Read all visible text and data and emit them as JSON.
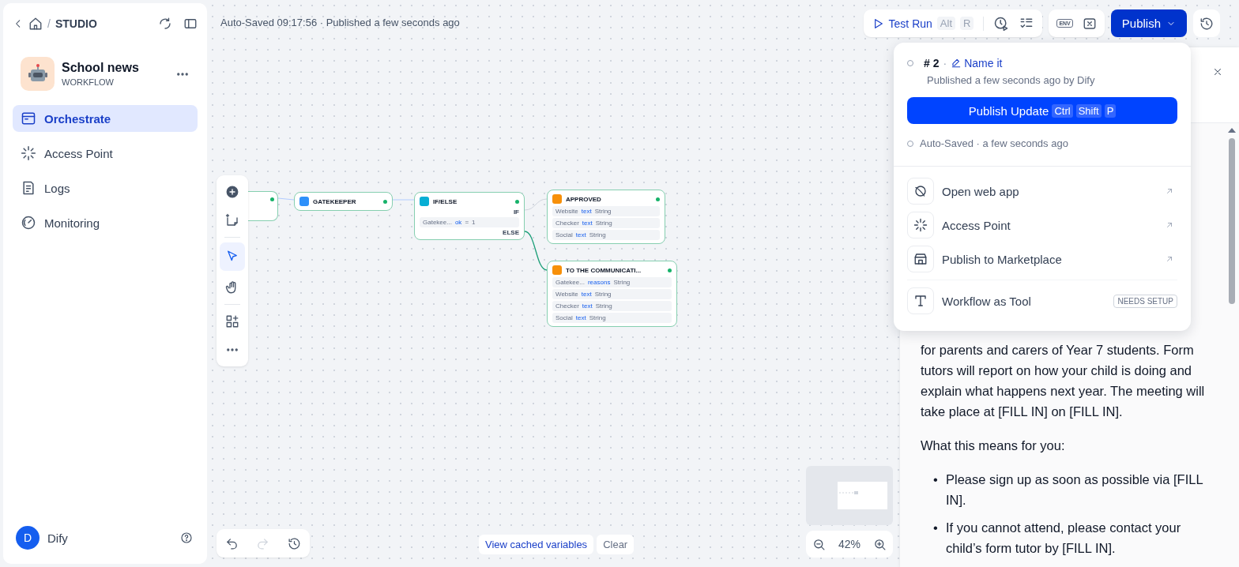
{
  "sidebar": {
    "back_separator": "/",
    "breadcrumb": "STUDIO",
    "app": {
      "name": "School news",
      "type": "WORKFLOW"
    },
    "nav": [
      {
        "label": "Orchestrate",
        "kind": "orchestrate",
        "selected": true
      },
      {
        "label": "Access Point",
        "kind": "access",
        "selected": false
      },
      {
        "label": "Logs",
        "kind": "logs",
        "selected": false
      },
      {
        "label": "Monitoring",
        "kind": "monitor",
        "selected": false
      }
    ],
    "user": {
      "initial": "D",
      "name": "Dify"
    }
  },
  "header": {
    "status": "Auto-Saved 09:17:56 · Published a few seconds ago",
    "test_run": {
      "label": "Test Run",
      "keys": [
        "Alt",
        "R"
      ]
    },
    "env": "ENV",
    "publish": "Publish"
  },
  "canvas": {
    "tools": [
      {
        "kind": "add",
        "selected": false
      },
      {
        "kind": "note",
        "selected": false
      },
      {
        "kind": "pointer",
        "selected": true
      },
      {
        "kind": "hand",
        "selected": false
      },
      {
        "kind": "grid",
        "selected": false
      },
      {
        "kind": "more",
        "selected": false
      }
    ],
    "nodes": [
      {
        "kind": "partial"
      },
      {
        "kind": "code",
        "title": "GATEKEEPER"
      },
      {
        "kind": "ifelse",
        "title": "IF/ELSE",
        "if_label": "IF",
        "else_label": "ELSE",
        "condition": {
          "source": "Gatekee...",
          "var": "ok",
          "op": "=",
          "value": "1"
        }
      },
      {
        "kind": "template",
        "title": "APPROVED",
        "rows": [
          {
            "source": "Website",
            "var": "text",
            "type": "String"
          },
          {
            "source": "Checker",
            "var": "text",
            "type": "String"
          },
          {
            "source": "Social",
            "var": "text",
            "type": "String"
          }
        ]
      },
      {
        "kind": "template",
        "title": "TO THE COMMUNICATI...",
        "rows": [
          {
            "source": "Gatekee...",
            "var": "reasons",
            "type": "String"
          },
          {
            "source": "Website",
            "var": "text",
            "type": "String"
          },
          {
            "source": "Checker",
            "var": "text",
            "type": "String"
          },
          {
            "source": "Social",
            "var": "text",
            "type": "String"
          }
        ]
      }
    ],
    "cached_link": "View cached variables",
    "clear": "Clear",
    "zoom": "42%"
  },
  "publish_menu": {
    "version": "# 2",
    "separator": "·",
    "name_link": "Name it",
    "published": "Published a few seconds ago by Dify",
    "update_button": {
      "label": "Publish Update",
      "keys": [
        "Ctrl",
        "Shift",
        "P"
      ]
    },
    "autosaved": "Auto-Saved · a few seconds ago",
    "actions": [
      {
        "kind": "web",
        "label": "Open web app",
        "external": true
      },
      {
        "kind": "access",
        "label": "Access Point",
        "external": true
      },
      {
        "kind": "store",
        "label": "Publish to Marketplace",
        "external": true
      },
      {
        "kind": "tool",
        "label": "Workflow as Tool",
        "external": false,
        "badge": "NEEDS SETUP"
      }
    ]
  },
  "result_panel": {
    "paragraph": "for parents and carers of Year 7 students. Form tutors will report on how your child is doing and explain what happens next year. The meeting will take place at [FILL IN] on [FILL IN].",
    "heading": "What this means for you:",
    "bullets": [
      {
        "marker": "•",
        "text": "Please sign up as soon as possible via [FILL IN]."
      },
      {
        "marker": "•",
        "text": "If you cannot attend, please contact your child’s form tutor by [FILL IN]."
      }
    ]
  }
}
